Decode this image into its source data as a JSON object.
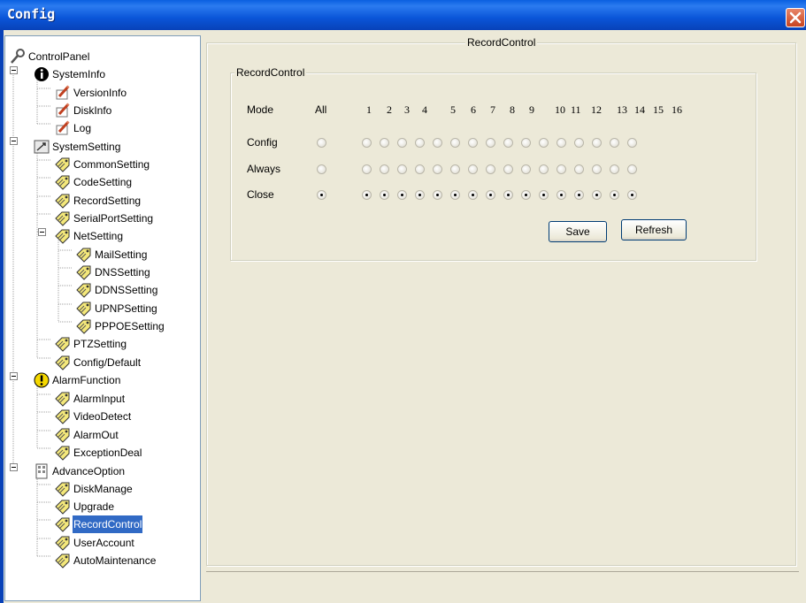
{
  "window": {
    "title": "Config"
  },
  "tree": [
    {
      "label": "ControlPanel",
      "icon": "wrench-icon"
    },
    {
      "label": "SystemInfo",
      "icon": "info-icon"
    },
    {
      "label": "VersionInfo",
      "icon": "pencil-note-icon"
    },
    {
      "label": "DiskInfo",
      "icon": "pencil-note-icon"
    },
    {
      "label": "Log",
      "icon": "pencil-note-icon"
    },
    {
      "label": "SystemSetting",
      "icon": "settings-icon"
    },
    {
      "label": "CommonSetting",
      "icon": "tag-icon"
    },
    {
      "label": "CodeSetting",
      "icon": "tag-icon"
    },
    {
      "label": "RecordSetting",
      "icon": "tag-icon"
    },
    {
      "label": "SerialPortSetting",
      "icon": "tag-icon"
    },
    {
      "label": "NetSetting",
      "icon": "tag-icon"
    },
    {
      "label": "MailSetting",
      "icon": "tag-icon"
    },
    {
      "label": "DNSSetting",
      "icon": "tag-icon"
    },
    {
      "label": "DDNSSetting",
      "icon": "tag-icon"
    },
    {
      "label": "UPNPSetting",
      "icon": "tag-icon"
    },
    {
      "label": "PPPOESetting",
      "icon": "tag-icon"
    },
    {
      "label": "PTZSetting",
      "icon": "tag-icon"
    },
    {
      "label": "Config/Default",
      "icon": "tag-icon"
    },
    {
      "label": "AlarmFunction",
      "icon": "warning-icon"
    },
    {
      "label": "AlarmInput",
      "icon": "tag-icon"
    },
    {
      "label": "VideoDetect",
      "icon": "tag-icon"
    },
    {
      "label": "AlarmOut",
      "icon": "tag-icon"
    },
    {
      "label": "ExceptionDeal",
      "icon": "tag-icon"
    },
    {
      "label": "AdvanceOption",
      "icon": "building-icon"
    },
    {
      "label": "DiskManage",
      "icon": "tag-icon"
    },
    {
      "label": "Upgrade",
      "icon": "tag-icon"
    },
    {
      "label": "RecordControl",
      "icon": "tag-icon",
      "selected": true
    },
    {
      "label": "UserAccount",
      "icon": "tag-icon"
    },
    {
      "label": "AutoMaintenance",
      "icon": "tag-icon"
    }
  ],
  "panel": {
    "outer_title": "RecordControl",
    "inner_title": "RecordControl",
    "mode_label": "Mode",
    "all_label": "All",
    "channels": [
      "1",
      "2",
      "3",
      "4",
      "5",
      "6",
      "7",
      "8",
      "9",
      "10",
      "11",
      "12",
      "13",
      "14",
      "15",
      "16"
    ],
    "rows": [
      {
        "label": "Config",
        "selected": false
      },
      {
        "label": "Always",
        "selected": false
      },
      {
        "label": "Close",
        "selected": true
      }
    ],
    "save_label": "Save",
    "refresh_label": "Refresh"
  },
  "colors": {
    "title_bar": "#0a55d8",
    "selection": "#316ac5",
    "close_button": "#c8431f"
  }
}
